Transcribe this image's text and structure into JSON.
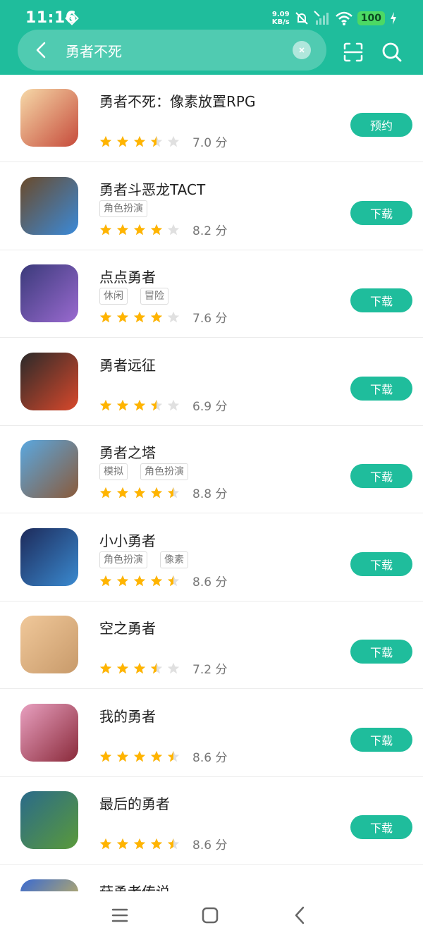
{
  "status_bar": {
    "time": "11:16",
    "net_speed_value": "9.09",
    "net_speed_unit": "KB/s",
    "battery": "100"
  },
  "search": {
    "query": "勇者不死",
    "icons": {
      "back": "back-arrow-icon",
      "clear": "clear-x-icon",
      "scan": "scan-icon",
      "search": "search-icon"
    }
  },
  "colors": {
    "accent": "#1fbd9c",
    "star_filled": "#ffb400",
    "star_empty": "#e0e0e0"
  },
  "apps": [
    {
      "name": "勇者不死：像素放置RPG",
      "tags": [],
      "stars": 3.5,
      "score": "7.0 分",
      "action": "预约"
    },
    {
      "name": "勇者斗恶龙TACT",
      "tags": [
        "角色扮演"
      ],
      "stars": 4,
      "score": "8.2 分",
      "action": "下载"
    },
    {
      "name": "点点勇者",
      "tags": [
        "休闲",
        "冒险"
      ],
      "stars": 4,
      "score": "7.6 分",
      "action": "下载"
    },
    {
      "name": "勇者远征",
      "tags": [],
      "stars": 3.5,
      "score": "6.9 分",
      "action": "下载"
    },
    {
      "name": "勇者之塔",
      "tags": [
        "模拟",
        "角色扮演"
      ],
      "stars": 4.5,
      "score": "8.8 分",
      "action": "下载"
    },
    {
      "name": "小小勇者",
      "tags": [
        "角色扮演",
        "像素"
      ],
      "stars": 4.5,
      "score": "8.6 分",
      "action": "下载"
    },
    {
      "name": "空之勇者",
      "tags": [],
      "stars": 3.5,
      "score": "7.2 分",
      "action": "下载"
    },
    {
      "name": "我的勇者",
      "tags": [],
      "stars": 4.5,
      "score": "8.6 分",
      "action": "下载"
    },
    {
      "name": "最后的勇者",
      "tags": [],
      "stars": 4.5,
      "score": "8.6 分",
      "action": "下载"
    },
    {
      "name": "菇勇者传说",
      "tags": [],
      "stars": 0,
      "score": "",
      "action": ""
    }
  ],
  "nav_bar": {
    "icons": [
      "menu-icon",
      "home-icon",
      "back-icon"
    ]
  }
}
